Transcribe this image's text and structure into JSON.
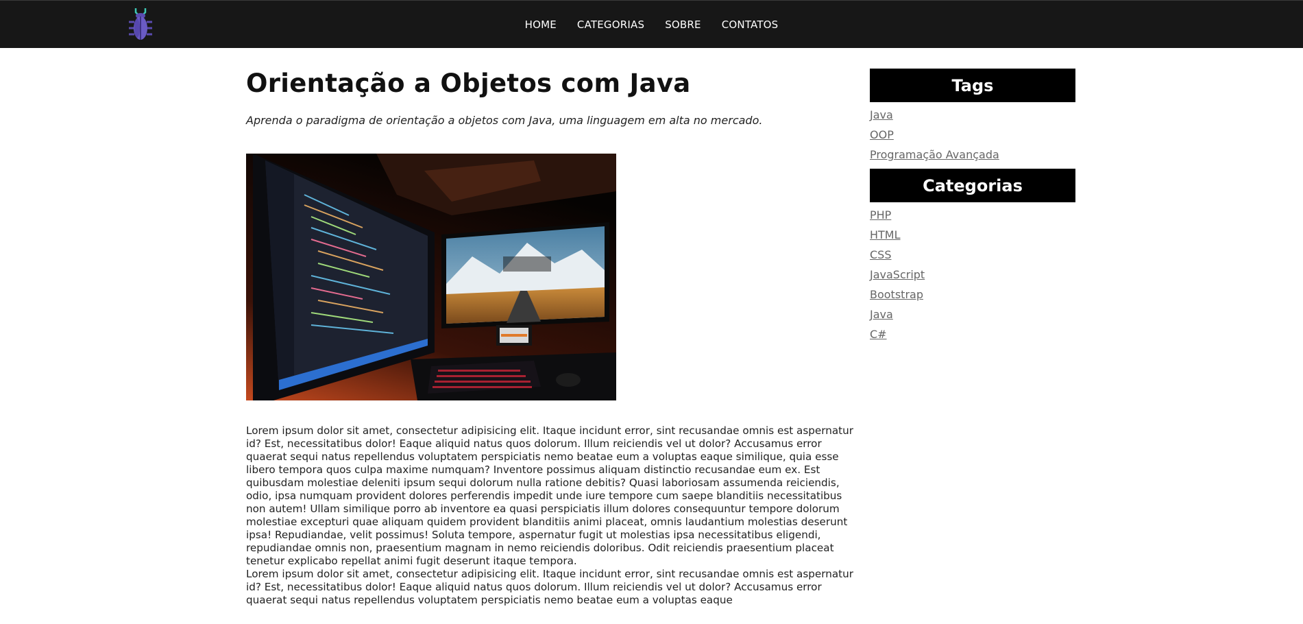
{
  "nav": {
    "logo_icon": "bug-icon",
    "links": [
      "HOME",
      "CATEGORIAS",
      "SOBRE",
      "CONTATOS"
    ]
  },
  "post": {
    "title": "Orientação a Objetos com Java",
    "subtitle": "Aprenda o paradigma de orientação a objetos com Java, uma linguagem em alta no mercado.",
    "paragraphs": [
      "Lorem ipsum dolor sit amet, consectetur adipisicing elit. Itaque incidunt error, sint recusandae omnis est aspernatur id? Est, necessitatibus dolor! Eaque aliquid natus quos dolorum. Illum reiciendis vel ut dolor? Accusamus error quaerat sequi natus repellendus voluptatem perspiciatis nemo beatae eum a voluptas eaque similique, quia esse libero tempora quos culpa maxime numquam? Inventore possimus aliquam distinctio recusandae eum ex. Est quibusdam molestiae deleniti ipsum sequi dolorum nulla ratione debitis? Quasi laboriosam assumenda reiciendis, odio, ipsa numquam provident dolores perferendis impedit unde iure tempore cum saepe blanditiis necessitatibus non autem! Ullam similique porro ab inventore ea quasi perspiciatis illum dolores consequuntur tempore dolorum molestiae excepturi quae aliquam quidem provident blanditiis animi placeat, omnis laudantium molestias deserunt ipsa! Repudiandae, velit possimus! Soluta tempore, aspernatur fugit ut molestias ipsa necessitatibus eligendi, repudiandae omnis non, praesentium magnam in nemo reiciendis doloribus. Odit reiciendis praesentium placeat tenetur explicabo repellat animi fugit deserunt itaque tempora.",
      "Lorem ipsum dolor sit amet, consectetur adipisicing elit. Itaque incidunt error, sint recusandae omnis est aspernatur id? Est, necessitatibus dolor! Eaque aliquid natus quos dolorum. Illum reiciendis vel ut dolor? Accusamus error quaerat sequi natus repellendus voluptatem perspiciatis nemo beatae eum a voluptas eaque"
    ]
  },
  "sidebar": {
    "tags_title": "Tags",
    "tags": [
      "Java",
      "OOP",
      "Programação Avançada"
    ],
    "categories_title": "Categorias",
    "categories": [
      "PHP",
      "HTML",
      "CSS",
      "JavaScript",
      "Bootstrap",
      "Java",
      "C#"
    ]
  },
  "colors": {
    "navbar_bg": "#171717",
    "logo_purple": "#5a4bb0",
    "logo_teal": "#3ec8b4",
    "sidebar_header_bg": "#000000",
    "link_gray": "#666666"
  }
}
